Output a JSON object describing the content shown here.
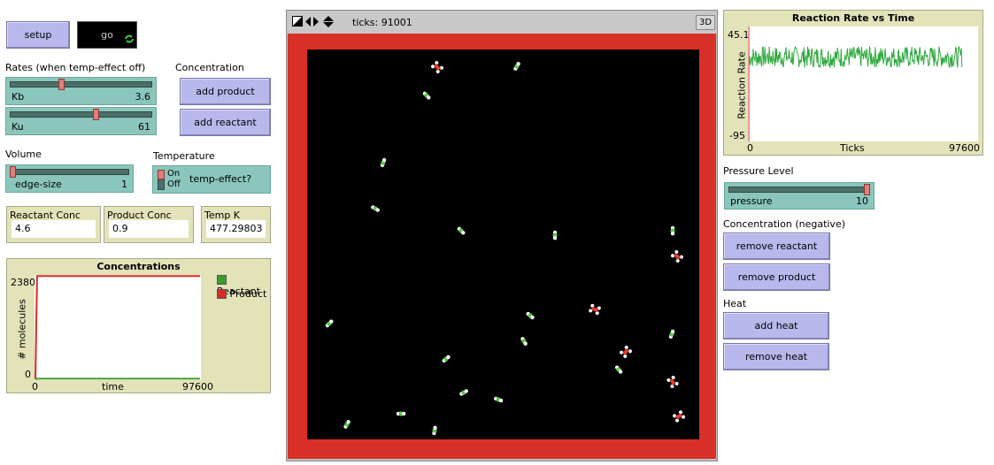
{
  "buttons": {
    "setup": "setup",
    "go": "go",
    "add_product": "add product",
    "add_reactant": "add reactant",
    "remove_reactant": "remove reactant",
    "remove_product": "remove product",
    "add_heat": "add heat",
    "remove_heat": "remove heat"
  },
  "labels": {
    "rates": "Rates (when temp-effect off)",
    "concentration": "Concentration",
    "volume": "Volume",
    "temperature": "Temperature",
    "pressure_level": "Pressure Level",
    "concentration_negative": "Concentration (negative)",
    "heat": "Heat"
  },
  "sliders": {
    "kb": {
      "name": "Kb",
      "value": "3.6",
      "fraction": 0.36
    },
    "ku": {
      "name": "Ku",
      "value": "61",
      "fraction": 0.61
    },
    "edge_size": {
      "name": "edge-size",
      "value": "1",
      "fraction": 0.0
    },
    "pressure": {
      "name": "pressure",
      "value": "10",
      "fraction": 1.0
    }
  },
  "switch": {
    "on": "On",
    "off": "Off",
    "name": "temp-effect?",
    "state": "off"
  },
  "monitors": {
    "reactant_conc": {
      "title": "Reactant Conc",
      "value": "4.6"
    },
    "product_conc": {
      "title": "Product Conc",
      "value": "0.9"
    },
    "temp_k": {
      "title": "Temp K",
      "value": "477.29803"
    }
  },
  "view": {
    "ticks": "ticks: 91001",
    "btn_3d": "3D",
    "border_color": "#d83028",
    "background": "#000000"
  },
  "conc_plot": {
    "title": "Concentrations",
    "ylabel": "# molecules",
    "xlabel": "time",
    "ymax": "2380",
    "ymin": "0",
    "xmin": "0",
    "xmax": "97600",
    "legend": [
      {
        "name": "Reactant",
        "color": "#3c9c2c"
      },
      {
        "name": "Product",
        "color": "#d82c24"
      }
    ]
  },
  "rate_plot": {
    "title": "Reaction Rate vs Time",
    "ylabel": "Reaction Rate",
    "xlabel": "Ticks",
    "ymax": "45.1",
    "ymin": "-95",
    "xmin": "0",
    "xmax": "97600",
    "color": "#2ca83c"
  },
  "chart_data": [
    {
      "type": "line",
      "title": "Concentrations",
      "xlabel": "time",
      "ylabel": "# molecules",
      "xlim": [
        0,
        97600
      ],
      "ylim": [
        0,
        2380
      ],
      "legend": "right",
      "series": [
        {
          "name": "Reactant",
          "x": [
            0,
            1000,
            97600
          ],
          "values": [
            0,
            12,
            12
          ]
        },
        {
          "name": "Product",
          "x": [
            0,
            1000,
            97600
          ],
          "values": [
            0,
            2375,
            2375
          ]
        }
      ]
    },
    {
      "type": "line",
      "title": "Reaction Rate vs Time",
      "xlabel": "Ticks",
      "ylabel": "Reaction Rate",
      "xlim": [
        0,
        97600
      ],
      "ylim": [
        -95,
        45.1
      ],
      "series": [
        {
          "x": [
            0,
            5000,
            91001
          ],
          "values": [
            0,
            0,
            0
          ]
        }
      ]
    }
  ]
}
